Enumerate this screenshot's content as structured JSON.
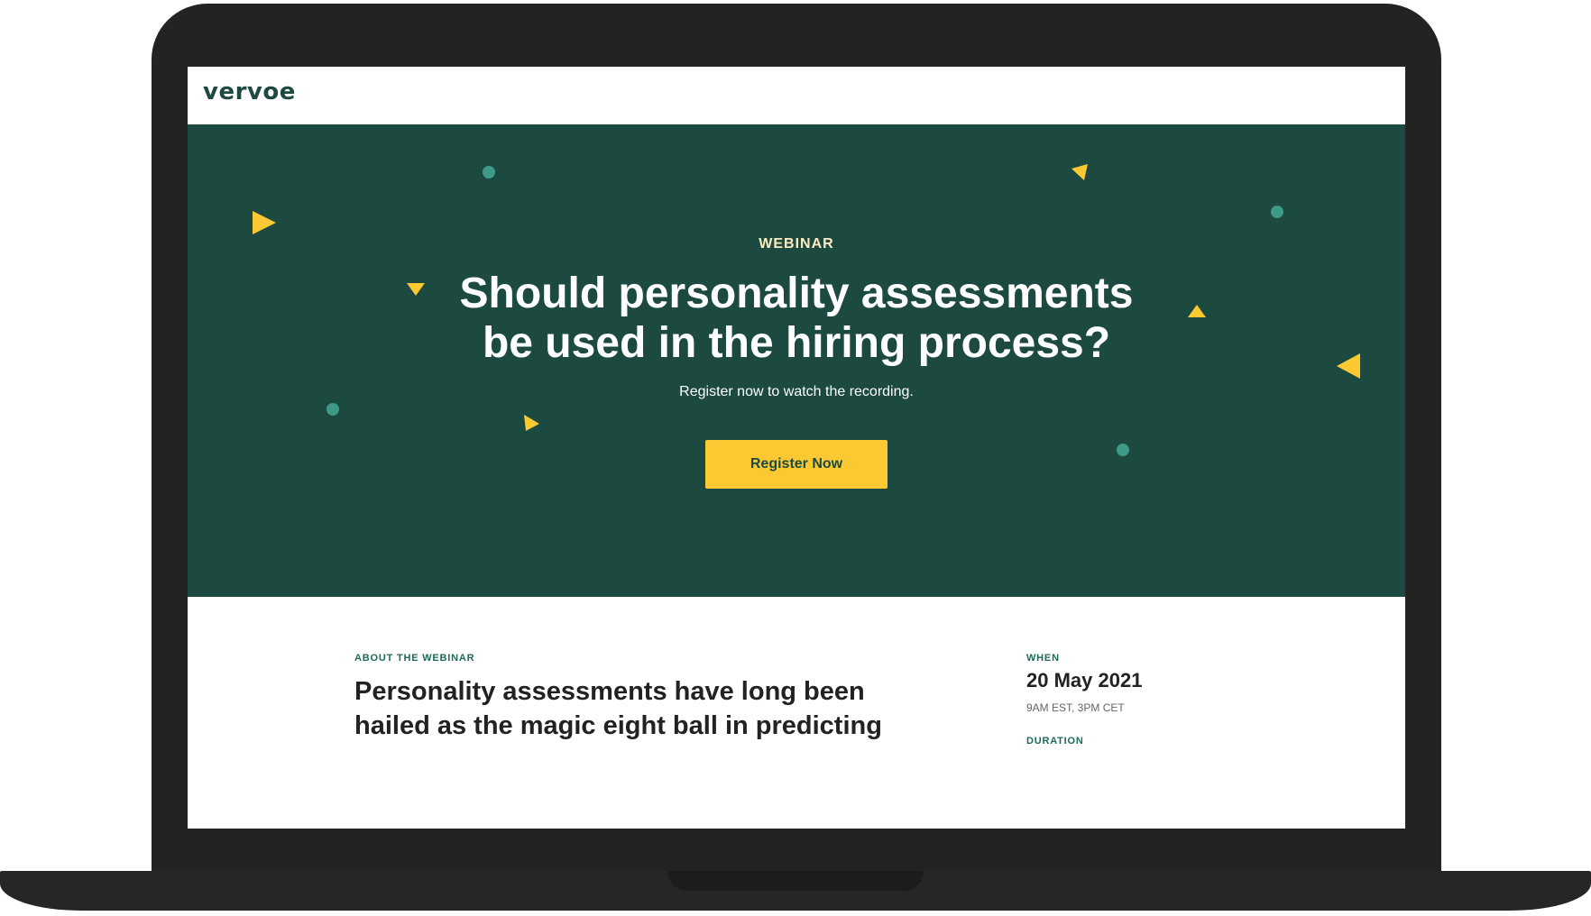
{
  "site": {
    "logo_text": "vervoe"
  },
  "hero": {
    "eyebrow": "WEBINAR",
    "headline_line1": "Should personality assessments",
    "headline_line2": "be used in the hiring process?",
    "subtitle": "Register now to watch the recording.",
    "cta_label": "Register Now"
  },
  "about": {
    "label": "ABOUT THE WEBINAR",
    "heading_line1": "Personality assessments have long been",
    "heading_line2": "hailed as the magic eight ball in predicting"
  },
  "details": {
    "when_label": "WHEN",
    "date": "20 May 2021",
    "time": "9AM EST, 3PM CET",
    "duration_label": "DURATION"
  },
  "colors": {
    "brand_green": "#1c4a40",
    "accent_yellow": "#fdc933",
    "dot_teal": "#3c9a86"
  }
}
